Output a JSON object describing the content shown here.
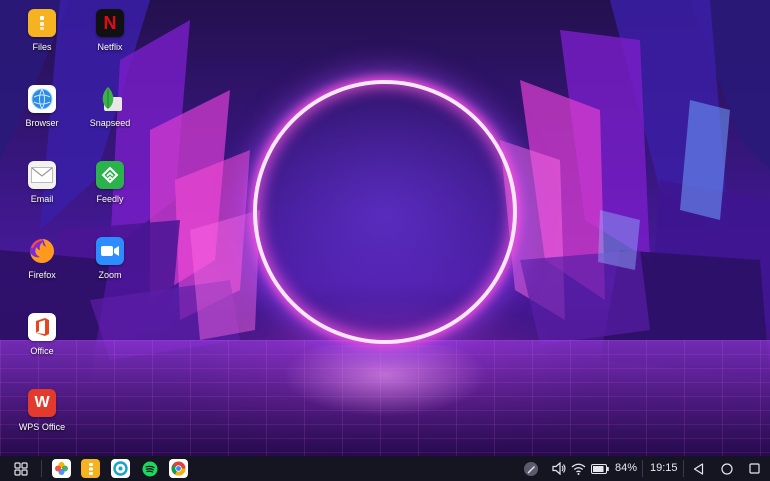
{
  "desktop": {
    "icons": [
      {
        "name": "files",
        "label": "Files"
      },
      {
        "name": "netflix",
        "label": "Netflix"
      },
      {
        "name": "browser",
        "label": "Browser"
      },
      {
        "name": "snapseed",
        "label": "Snapseed"
      },
      {
        "name": "email",
        "label": "Email"
      },
      {
        "name": "feedly",
        "label": "Feedly"
      },
      {
        "name": "firefox",
        "label": "Firefox"
      },
      {
        "name": "zoom",
        "label": "Zoom"
      },
      {
        "name": "office",
        "label": "Office"
      },
      {
        "name": "wps-office",
        "label": "WPS Office"
      }
    ],
    "icon_glyphs": {
      "netflix": "N",
      "office": "O",
      "wps": "W"
    }
  },
  "taskbar": {
    "pinned_apps": [
      "app-drawer-icon",
      "gallery-icon",
      "files-icon",
      "browser-icon",
      "spotify-icon",
      "chrome-icon"
    ],
    "battery_percent": "84%",
    "time": "19:15",
    "system_icons": [
      "stylus-icon",
      "volume-icon",
      "wifi-icon",
      "battery-icon"
    ],
    "nav_buttons": [
      "back-icon",
      "home-icon",
      "recents-icon"
    ]
  },
  "colors": {
    "taskbar_bg": "#151522",
    "ring_glow": "#ff50dc",
    "wallpaper_purple": "#4b1aa0"
  }
}
